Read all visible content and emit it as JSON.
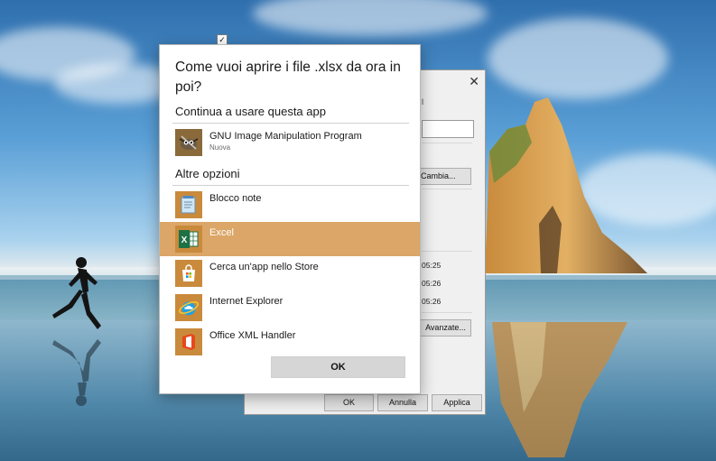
{
  "dialog": {
    "title": "Come vuoi aprire i file .xlsx da ora in poi?",
    "continue_heading": "Continua a usare questa app",
    "current_app": {
      "name": "GNU Image Manipulation Program",
      "badge": "Nuova",
      "icon": "gimp-icon"
    },
    "other_heading": "Altre opzioni",
    "options": [
      {
        "name": "Blocco note",
        "icon": "notepad-icon",
        "selected": false
      },
      {
        "name": "Excel",
        "icon": "excel-icon",
        "selected": true
      },
      {
        "name": "Cerca un'app nello Store",
        "icon": "store-icon",
        "selected": false
      },
      {
        "name": "Internet Explorer",
        "icon": "internet-explorer-icon",
        "selected": false
      },
      {
        "name": "Office XML Handler",
        "icon": "office-icon",
        "selected": false
      }
    ],
    "ok_label": "OK",
    "selected_color": "#dba667"
  },
  "background_window": {
    "close_glyph": "✕",
    "tab_glyph": "l",
    "change_label": "Cambia...",
    "times": [
      "05:25",
      "05:26",
      "05:26"
    ],
    "advanced_label": "Avanzate...",
    "buttons": {
      "ok": "OK",
      "cancel": "Annulla",
      "apply": "Applica"
    }
  },
  "desktop": {
    "checkbox_glyph": "✓"
  }
}
